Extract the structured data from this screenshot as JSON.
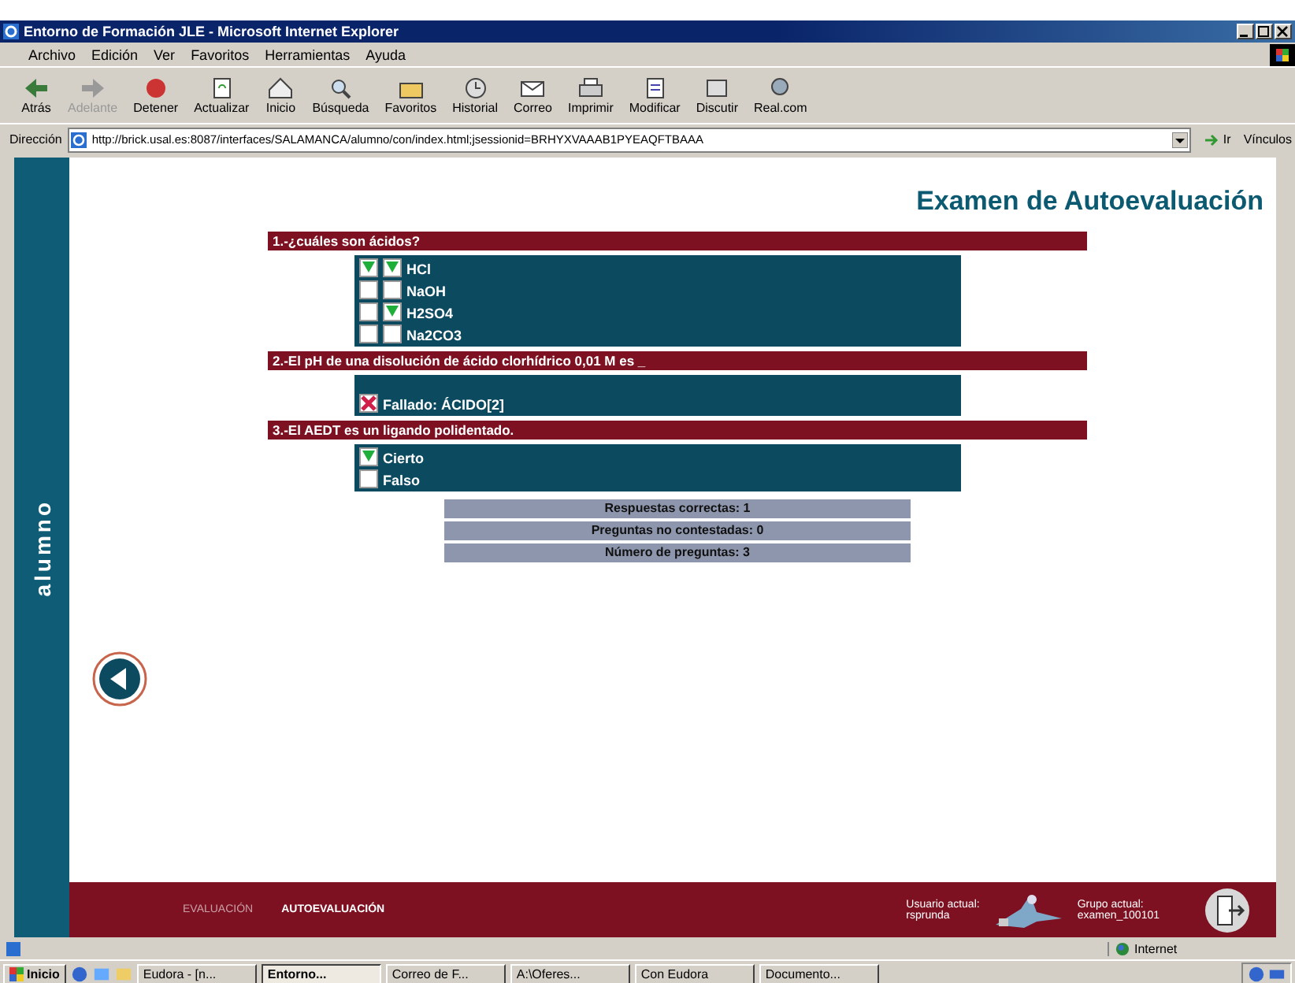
{
  "window": {
    "title": "Entorno de Formación JLE - Microsoft Internet Explorer"
  },
  "menu": [
    "Archivo",
    "Edición",
    "Ver",
    "Favoritos",
    "Herramientas",
    "Ayuda"
  ],
  "toolbar": [
    {
      "label": "Atrás",
      "disabled": false
    },
    {
      "label": "Adelante",
      "disabled": true
    },
    {
      "label": "Detener",
      "disabled": false
    },
    {
      "label": "Actualizar",
      "disabled": false
    },
    {
      "label": "Inicio",
      "disabled": false
    },
    {
      "label": "Búsqueda",
      "disabled": false
    },
    {
      "label": "Favoritos",
      "disabled": false
    },
    {
      "label": "Historial",
      "disabled": false
    },
    {
      "label": "Correo",
      "disabled": false
    },
    {
      "label": "Imprimir",
      "disabled": false
    },
    {
      "label": "Modificar",
      "disabled": false
    },
    {
      "label": "Discutir",
      "disabled": false
    },
    {
      "label": "Real.com",
      "disabled": false
    }
  ],
  "address": {
    "label": "Dirección",
    "value": "http://brick.usal.es:8087/interfaces/SALAMANCA/alumno/con/index.html;jsessionid=BRHYXVAAAB1PYEAQFTBAAA",
    "go": "Ir",
    "links": "Vínculos"
  },
  "sidebar": {
    "label": "alumno"
  },
  "heading": "Examen de Autoevaluación",
  "questions": [
    {
      "text": "1.-¿cuáles son ácidos?",
      "options": [
        {
          "kind": "check",
          "label": "HCl",
          "boxes": [
            {
              "checked": true
            },
            {
              "checked": true
            }
          ]
        },
        {
          "kind": "check",
          "label": "NaOH",
          "boxes": [
            {
              "checked": false
            },
            {
              "checked": false
            }
          ]
        },
        {
          "kind": "check",
          "label": "H2SO4",
          "boxes": [
            {
              "checked": false
            },
            {
              "checked": true
            }
          ]
        },
        {
          "kind": "check",
          "label": "Na2CO3",
          "boxes": [
            {
              "checked": false
            },
            {
              "checked": false
            }
          ]
        }
      ]
    },
    {
      "text": "2.-El pH de una disolución de ácido clorhídrico 0,01 M es _",
      "options": [
        {
          "kind": "result",
          "label": "Fallado: ÁCIDO[2]",
          "correct": false
        }
      ]
    },
    {
      "text": "3.-El AEDT es un ligando polidentado.",
      "options": [
        {
          "kind": "check",
          "label": "Cierto",
          "boxes": [
            {
              "checked": true
            }
          ]
        },
        {
          "kind": "check",
          "label": "Falso",
          "boxes": [
            {
              "checked": false
            }
          ]
        }
      ]
    }
  ],
  "summary": [
    "Respuestas correctas: 1",
    "Preguntas no contestadas: 0",
    "Número de preguntas: 3"
  ],
  "footer": {
    "nav": [
      {
        "label": "EVALUACIÓN",
        "selected": false
      },
      {
        "label": "AUTOEVALUACIÓN",
        "selected": true
      }
    ],
    "user_label": "Usuario actual:",
    "user": "rsprunda",
    "group_label": "Grupo actual:",
    "group": "examen_100101"
  },
  "status_bar": {
    "zone": "Internet"
  },
  "taskbar": {
    "start": "Inicio",
    "tasks": [
      {
        "label": "Eudora - [n...",
        "selected": false
      },
      {
        "label": "Entorno...",
        "selected": true
      },
      {
        "label": "Correo de F...",
        "selected": false
      },
      {
        "label": "A:\\Oferes...",
        "selected": false
      },
      {
        "label": "Con Eudora",
        "selected": false
      },
      {
        "label": "Documento...",
        "selected": false
      }
    ]
  }
}
